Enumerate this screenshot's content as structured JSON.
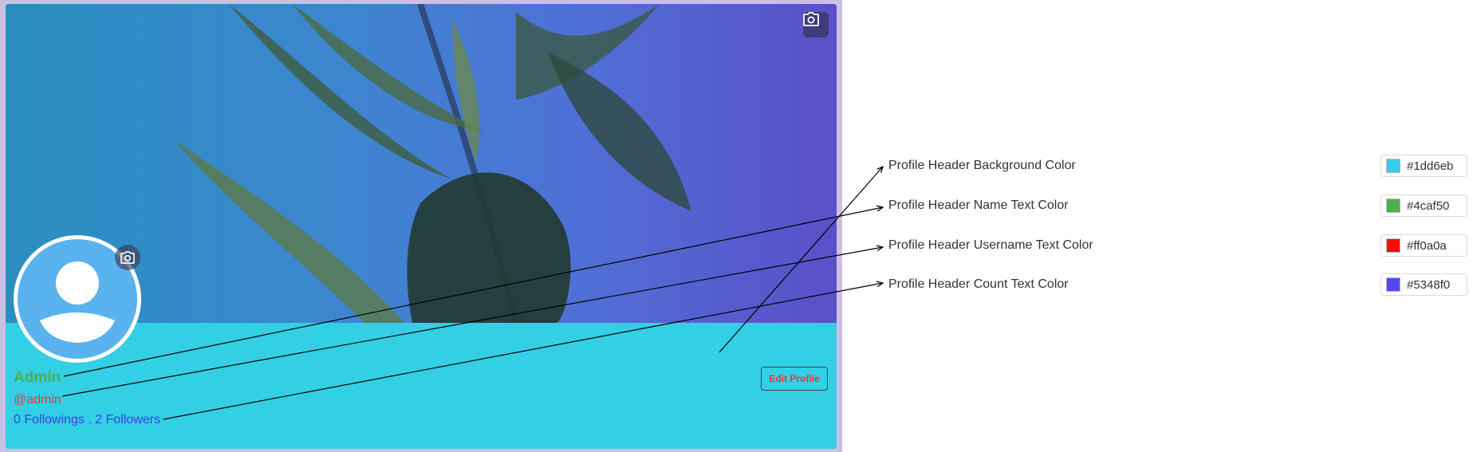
{
  "profile": {
    "name": "Admin",
    "username": "@admin",
    "counts": "0 Followings . 2 Followers",
    "edit_button": "Edit Profile"
  },
  "settings": [
    {
      "label": "Profile Header Background Color",
      "value": "#1dd6eb",
      "color": "#33cfe5"
    },
    {
      "label": "Profile Header Name Text Color",
      "value": "#4caf50",
      "color": "#4caf50"
    },
    {
      "label": "Profile Header Username Text Color",
      "value": "#ff0a0a",
      "color": "#ff0a0a"
    },
    {
      "label": "Profile Header Count Text Color",
      "value": "#5348f0",
      "color": "#5348f0"
    }
  ],
  "icons": {
    "cover_camera": "camera-icon",
    "avatar_camera": "camera-icon",
    "avatar": "user-silhouette-icon"
  }
}
